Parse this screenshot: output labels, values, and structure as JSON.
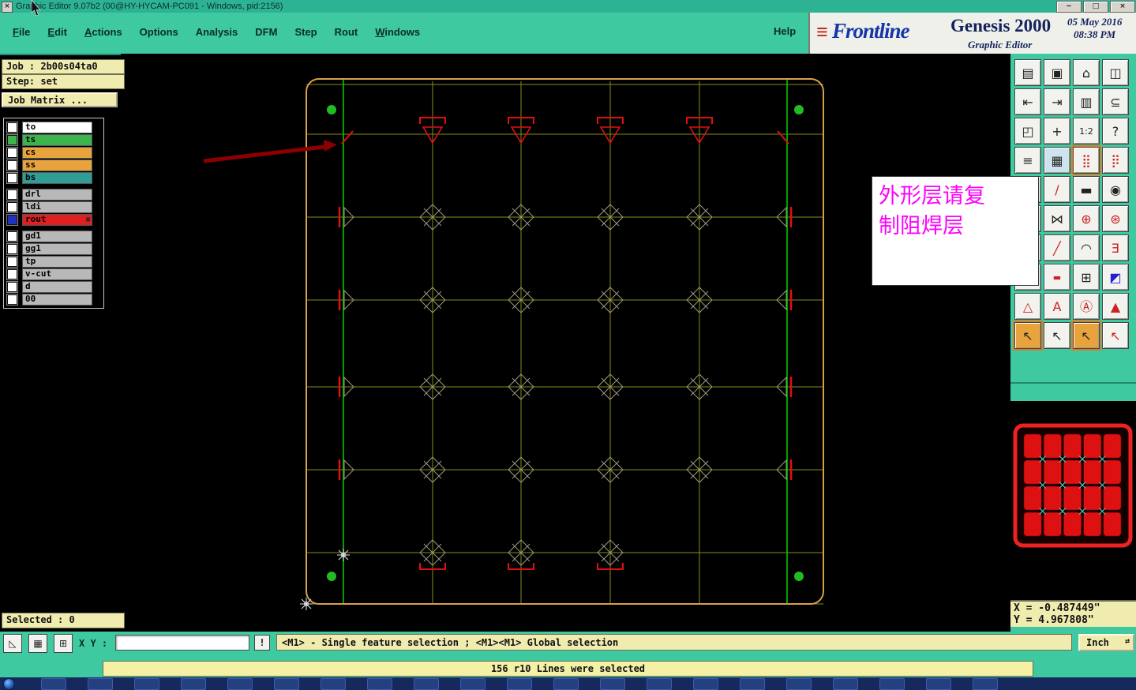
{
  "window": {
    "title": "Graphic Editor 9.07b2 (00@HY-HYCAM-PC091 - Windows, pid:2156)",
    "icon_glyph": "×",
    "controls": {
      "minimize": "‒",
      "maximize": "□",
      "close": "×"
    }
  },
  "menu": {
    "items": [
      {
        "label": "File",
        "u": 0
      },
      {
        "label": "Edit",
        "u": 0
      },
      {
        "label": "Actions",
        "u": 0
      },
      {
        "label": "Options",
        "u": -1
      },
      {
        "label": "Analysis",
        "u": -1
      },
      {
        "label": "DFM",
        "u": -1
      },
      {
        "label": "Step",
        "u": -1
      },
      {
        "label": "Rout",
        "u": -1
      },
      {
        "label": "Windows",
        "u": 0
      }
    ],
    "help": "Help"
  },
  "brand": {
    "logo_mark": "≡",
    "logo_text": "Frontline",
    "product": "Genesis 2000",
    "date": "05 May 2016",
    "time": "08:38 PM",
    "subtitle": "Graphic Editor"
  },
  "job_panel": {
    "job_label": "Job : 2b00s04ta0",
    "step_label": "Step: set",
    "matrix_button": "Job Matrix ...",
    "layers": [
      {
        "name": "to",
        "color": "#ffffff"
      },
      {
        "name": "ts",
        "color": "#3cb44b",
        "check_color": "#3cb44b"
      },
      {
        "name": "cs",
        "color": "#e8a33d"
      },
      {
        "name": "ss",
        "color": "#e8a33d"
      },
      {
        "name": "bs",
        "color": "#2f9e96"
      },
      {
        "name": "drl",
        "color": "#b8b8b8",
        "group_start": true
      },
      {
        "name": "ldi",
        "color": "#b8b8b8"
      },
      {
        "name": "rout",
        "color": "#e02020",
        "check_color": "#2233bb",
        "grid_icon": true
      },
      {
        "name": "gd1",
        "color": "#b8b8b8",
        "group_start": true
      },
      {
        "name": "gg1",
        "color": "#b8b8b8"
      },
      {
        "name": "tp",
        "color": "#b8b8b8"
      },
      {
        "name": "v-cut",
        "color": "#b8b8b8"
      },
      {
        "name": "d",
        "color": "#b8b8b8"
      },
      {
        "name": "00",
        "color": "#b8b8b8"
      }
    ]
  },
  "annotation": {
    "line1": "外形层请复",
    "line2": "制阻焊层",
    "text_color": "#ff00ff"
  },
  "canvas": {
    "background": "#000000",
    "panel_border_color": "#d8a04a",
    "grid_color": "#8a8a1a",
    "rail_color": "#00c800",
    "dot_color": "#22bb22",
    "feature_color": "#9a9a80",
    "selected_color": "#e01010",
    "marker_color": "#e6e6e6",
    "arrow_color": "#8b0000",
    "columns": 6,
    "rows": 6
  },
  "toolbar": {
    "rows": [
      [
        {
          "n": "job-open-icon",
          "g": "▤"
        },
        {
          "n": "screen-icon",
          "g": "▣"
        },
        {
          "n": "home-icon",
          "g": "⌂"
        },
        {
          "n": "tile-windows-icon",
          "g": "◫"
        }
      ],
      [
        {
          "n": "step-exit-icon",
          "g": "⇤"
        },
        {
          "n": "step-enter-icon",
          "g": "⇥"
        },
        {
          "n": "windows-stack-icon",
          "g": "▥"
        },
        {
          "n": "snap-modes-icon",
          "g": "⊆"
        }
      ],
      [
        {
          "n": "zoom-window-icon",
          "g": "◰"
        },
        {
          "n": "pan-center-icon",
          "g": "+"
        },
        {
          "n": "zoom-ratio-button",
          "g": "1:2",
          "small": true
        },
        {
          "n": "help-icon",
          "g": "?"
        }
      ],
      [
        {
          "n": "layer-table-icon",
          "g": "≡"
        },
        {
          "n": "grid-toggle-icon",
          "g": "▦",
          "bg": "#cfe3ee"
        },
        {
          "n": "layer-display-icon",
          "g": "⣿",
          "fg": "#cc2222",
          "sel": true
        },
        {
          "n": "layer-order-icon",
          "g": "⡿",
          "fg": "#cc2222"
        }
      ],
      [
        {
          "n": "profile-icon",
          "g": "▱",
          "fg": "#cc2222"
        },
        {
          "n": "sketch-icon",
          "g": "∕",
          "fg": "#cc2222"
        },
        {
          "n": "measure-icon",
          "g": "▬"
        },
        {
          "n": "pad-icon",
          "g": "◉"
        }
      ],
      [
        {
          "n": "swap-layer-icon",
          "g": "⇄",
          "fg": "#cc2222"
        },
        {
          "n": "break-icon",
          "g": "⋈"
        },
        {
          "n": "move-feature-icon",
          "g": "⊕",
          "fg": "#cc2222"
        },
        {
          "n": "copy-feature-icon",
          "g": "⊛",
          "fg": "#cc2222"
        }
      ],
      [
        {
          "n": "line-tool-icon",
          "g": "╲",
          "fg": "#2222cc"
        },
        {
          "n": "red-line-icon",
          "g": "╱",
          "fg": "#cc2222"
        },
        {
          "n": "arc-tool-icon",
          "g": "◠"
        },
        {
          "n": "flatten-icon",
          "g": "Ǝ",
          "fg": "#cc2222"
        }
      ],
      [
        {
          "n": "contour-icon",
          "g": "◑",
          "fg": "#cc2222"
        },
        {
          "n": "dash-icon",
          "g": "▬",
          "fg": "#cc2222",
          "small": true
        },
        {
          "n": "transform-icon",
          "g": "⊞"
        },
        {
          "n": "shape-lib-icon",
          "g": "◩",
          "fg": "#2222cc"
        }
      ],
      [
        {
          "n": "triangle-tool-icon",
          "g": "△",
          "fg": "#cc2222"
        },
        {
          "n": "text-move-icon",
          "g": "A",
          "fg": "#cc2222"
        },
        {
          "n": "text-edit-icon",
          "g": "Ⓐ",
          "fg": "#cc2222"
        },
        {
          "n": "triangle-drop-icon",
          "g": "▲",
          "fg": "#cc2222"
        }
      ],
      [
        {
          "n": "select-tool-button",
          "g": "↖",
          "bg": "#e8a33d",
          "sel": true
        },
        {
          "n": "select-single-button",
          "g": "↖"
        },
        {
          "n": "select-window-button",
          "g": "↖",
          "bg": "#e8a33d",
          "sel": true
        },
        {
          "n": "select-net-button",
          "g": "↖",
          "fg": "#cc2222"
        }
      ]
    ]
  },
  "thumbnail": {
    "border_color": "#ee2222",
    "fill_color": "#dd1111",
    "line_color": "#7a0000",
    "marker_color": "#40e0d0",
    "cols": 5,
    "rows": 4
  },
  "coords": {
    "x": "X = -0.487449\"",
    "y": "Y = 4.967808\""
  },
  "status": {
    "selected": "Selected : 0",
    "xy_label": "X Y :",
    "xy_value": "",
    "alert": "!",
    "message": "<M1> - Single feature selection ; <M1><M1> Global selection",
    "units": "Inch",
    "units_icon": "⇄",
    "result": "156 r10 Lines were selected"
  },
  "taskbar": {
    "app_count": 21
  }
}
